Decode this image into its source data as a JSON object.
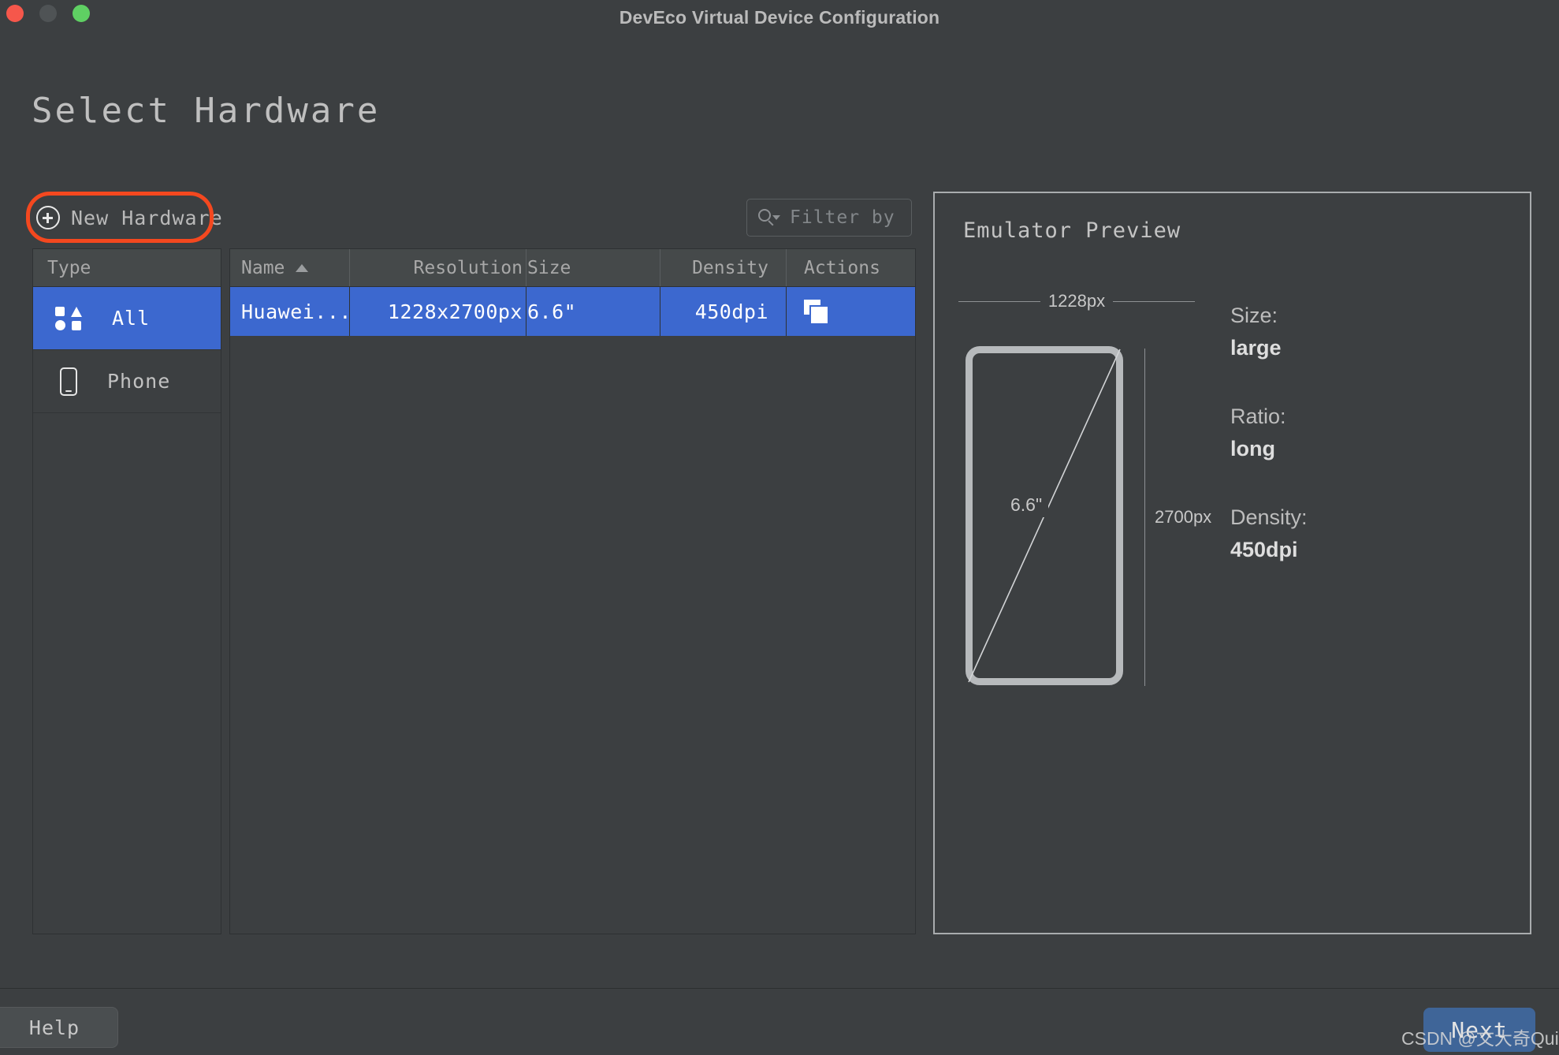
{
  "window": {
    "title": "DevEco Virtual Device Configuration",
    "traffic_lights": [
      "close",
      "minimize",
      "zoom"
    ]
  },
  "page": {
    "title": "Select Hardware"
  },
  "toolbar": {
    "new_hardware_label": "New Hardware",
    "new_hardware_icon": "plus-circle-icon",
    "annotation_color": "#f4481f"
  },
  "search": {
    "placeholder": "Filter by",
    "icon": "search-icon"
  },
  "type_panel": {
    "header": "Type",
    "items": [
      {
        "label": "All",
        "icon": "shapes-icon",
        "selected": true
      },
      {
        "label": "Phone",
        "icon": "phone-icon",
        "selected": false
      }
    ]
  },
  "table": {
    "columns": [
      {
        "label": "Name",
        "sort": "asc"
      },
      {
        "label": "Resolution",
        "sort": ""
      },
      {
        "label": "Size",
        "sort": ""
      },
      {
        "label": "Density",
        "sort": ""
      },
      {
        "label": "Actions",
        "sort": ""
      }
    ],
    "rows": [
      {
        "name": "Huawei...",
        "resolution": "1228x2700px",
        "size": "6.6\"",
        "density": "450dpi",
        "action_icon": "copy-icon",
        "selected": true
      }
    ]
  },
  "preview": {
    "title": "Emulator Preview",
    "width_label": "1228px",
    "height_label": "2700px",
    "diagonal_label": "6.6\"",
    "specs": [
      {
        "key": "Size:",
        "value": "large"
      },
      {
        "key": "Ratio:",
        "value": "long"
      },
      {
        "key": "Density:",
        "value": "450dpi"
      }
    ]
  },
  "footer": {
    "help_label": "Help",
    "next_label": "Next"
  },
  "watermark": {
    "text": "CSDN @文大奇Quiin"
  },
  "colors": {
    "background": "#3c3f41",
    "selection_blue": "#3c68cf",
    "next_blue": "#3f6598",
    "annotation_red": "#f4481f",
    "text": "#c2c2c2"
  }
}
